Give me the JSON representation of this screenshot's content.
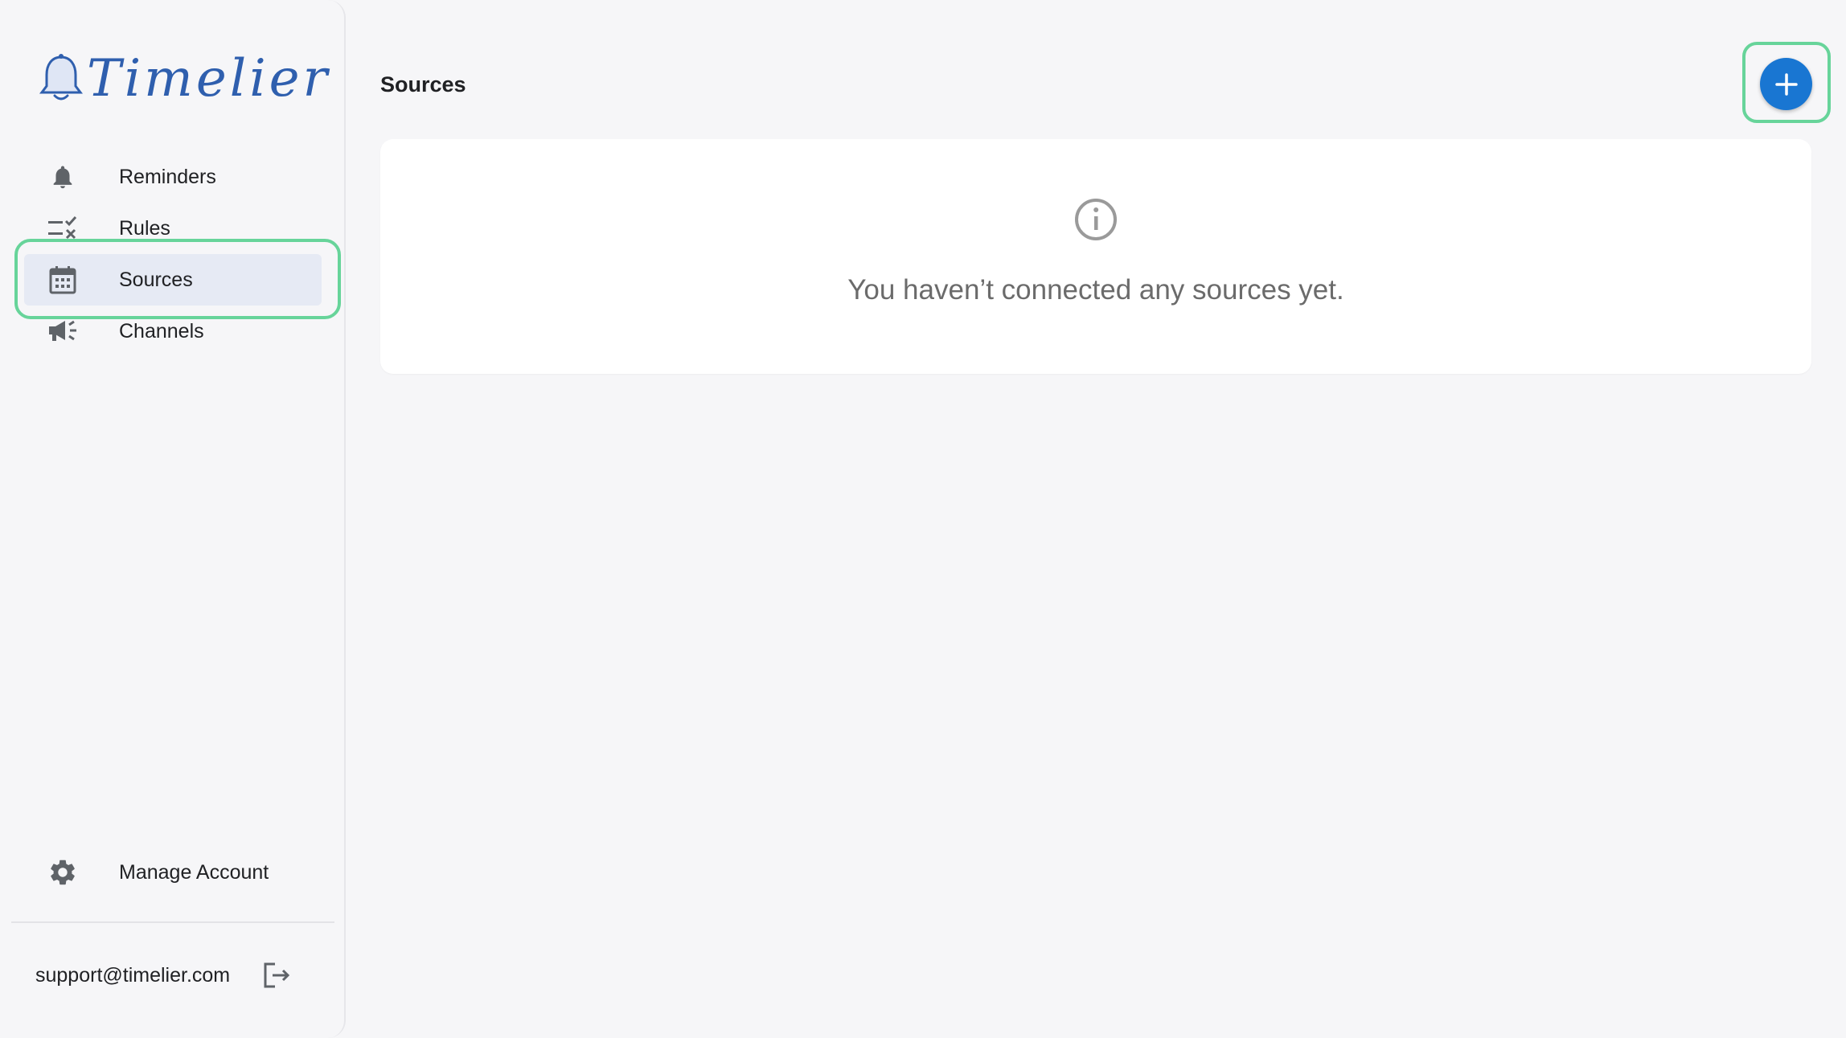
{
  "app": {
    "logo_text": "Timelier"
  },
  "sidebar": {
    "items": [
      {
        "label": "Reminders",
        "icon": "bell-icon",
        "active": false
      },
      {
        "label": "Rules",
        "icon": "rules-icon",
        "active": false
      },
      {
        "label": "Sources",
        "icon": "calendar-icon",
        "active": true
      },
      {
        "label": "Channels",
        "icon": "megaphone-icon",
        "active": false
      }
    ],
    "manage_account": {
      "label": "Manage Account",
      "icon": "gear-icon"
    },
    "footer": {
      "email": "support@timelier.com",
      "logout_icon": "logout-icon"
    }
  },
  "main": {
    "title": "Sources",
    "add_button_icon": "plus-icon",
    "empty_state": {
      "icon": "info-icon",
      "message": "You haven’t connected any sources yet."
    }
  },
  "colors": {
    "accent": "#1976d2",
    "highlight": "#67d49a",
    "active_bg": "#e6eaf4",
    "logo": "#2f5fae"
  }
}
